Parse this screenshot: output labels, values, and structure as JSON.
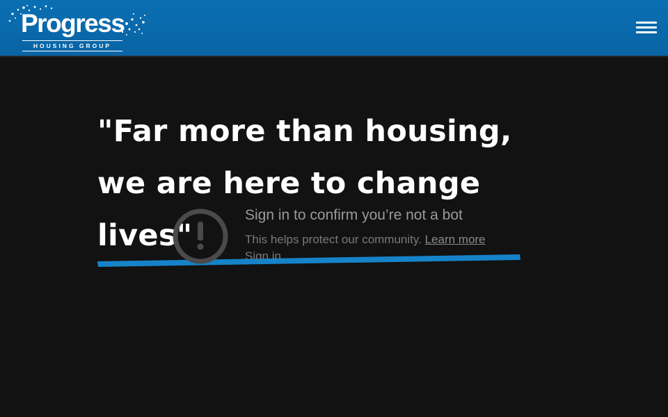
{
  "header": {
    "logo_word": "Progress",
    "logo_subtitle": "HOUSING GROUP",
    "brand_color": "#0a6fb3",
    "menu_icon": "hamburger-menu-icon"
  },
  "hero": {
    "headline": "\"Far more than housing, we are here to change lives\"",
    "accent_color": "#1683c9"
  },
  "bot_check": {
    "icon": "exclamation-circle-icon",
    "title": "Sign in to confirm you’re not a bot",
    "description": "This helps protect our community.",
    "learn_more": "Learn more",
    "sign_in": "Sign in"
  }
}
